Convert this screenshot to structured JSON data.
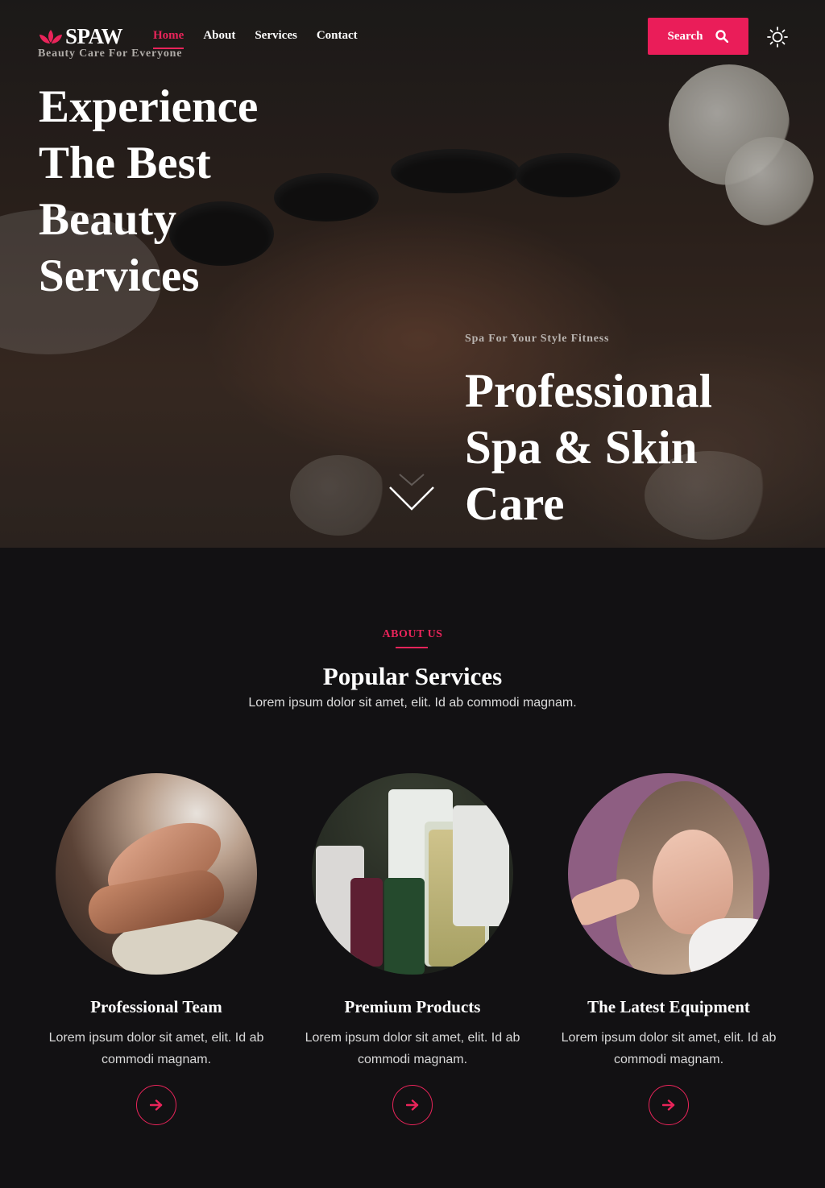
{
  "brand": {
    "name": "SPAW",
    "tagline": "Beauty Care For Everyone",
    "accent": "#e9245a"
  },
  "nav": {
    "items": [
      {
        "label": "Home",
        "active": true
      },
      {
        "label": "About",
        "active": false
      },
      {
        "label": "Services",
        "active": false
      },
      {
        "label": "Contact",
        "active": false
      }
    ]
  },
  "header": {
    "search_label": "Search",
    "search_icon": "magnifier-icon",
    "theme_icon": "sun-icon"
  },
  "hero": {
    "headline": "Experience The Best Beauty Services",
    "eyebrow": "Spa For Your Style Fitness",
    "subheadline": "Professional Spa & Skin Care",
    "scroll_icon": "chevron-down-icon"
  },
  "about": {
    "label": "ABOUT US",
    "title": "Popular Services",
    "subtitle": "Lorem ipsum dolor sit amet, elit. Id ab commodi magnam."
  },
  "services": [
    {
      "title": "Professional Team",
      "text": "Lorem ipsum dolor sit amet, elit. Id ab commodi magnam.",
      "icon": "arrow-right-icon"
    },
    {
      "title": "Premium Products",
      "text": "Lorem ipsum dolor sit amet, elit. Id ab commodi magnam.",
      "icon": "arrow-right-icon"
    },
    {
      "title": "The Latest Equipment",
      "text": "Lorem ipsum dolor sit amet, elit. Id ab commodi magnam.",
      "icon": "arrow-right-icon"
    }
  ],
  "colors": {
    "background": "#121113",
    "accent": "#e9245a",
    "button": "#ea1d59"
  }
}
